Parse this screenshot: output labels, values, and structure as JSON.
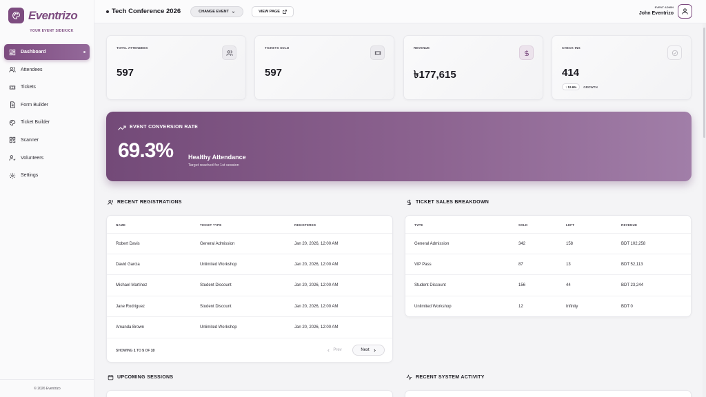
{
  "app": {
    "logo_text": "Eventrizo",
    "tagline": "YOUR EVENT SIDEKICK",
    "copyright": "© 2026 Eventrizo"
  },
  "colors": {
    "brand": "#7d4c80",
    "background": "#f4f4f6"
  },
  "sidebar": {
    "items": [
      {
        "label": "Dashboard",
        "icon": "dashboard-icon",
        "active": true
      },
      {
        "label": "Attendees",
        "icon": "users-icon"
      },
      {
        "label": "Tickets",
        "icon": "ticket-icon"
      },
      {
        "label": "Form Builder",
        "icon": "form-icon"
      },
      {
        "label": "Ticket Builder",
        "icon": "palette-icon"
      },
      {
        "label": "Scanner",
        "icon": "scan-icon"
      },
      {
        "label": "Volunteers",
        "icon": "volunteer-icon"
      },
      {
        "label": "Settings",
        "icon": "gear-icon"
      }
    ]
  },
  "header": {
    "event_title": "Tech Conference 2026",
    "change_event_label": "CHANGE EVENT",
    "view_page_label": "VIEW PAGE",
    "user_role": "EVENT ADMIN",
    "user_name": "John Eventrizo"
  },
  "stats": [
    {
      "label": "TOTAL ATTENDEES",
      "value": "597",
      "icon": "users-icon"
    },
    {
      "label": "TICKETS SOLD",
      "value": "597",
      "icon": "ticket-icon"
    },
    {
      "label": "REVENUE",
      "value": "৳177,615",
      "icon": "dollar-icon"
    },
    {
      "label": "CHECK-INS",
      "value": "414",
      "icon": "check-circle-icon",
      "growth": "↑ 12.6%",
      "growth_label": "GROWTH"
    }
  ],
  "conversion": {
    "title": "EVENT CONVERSION RATE",
    "rate": "69.3%",
    "status": "Healthy Attendance",
    "subtitle": "Target reached for 1st session"
  },
  "registrations": {
    "title": "RECENT REGISTRATIONS",
    "columns": [
      "NAME",
      "TICKET TYPE",
      "REGISTERED"
    ],
    "rows": [
      [
        "Robert Davis",
        "General Admission",
        "Jan 20, 2026, 12:00 AM"
      ],
      [
        "David Garcia",
        "Unlimited Workshop",
        "Jan 20, 2026, 12:00 AM"
      ],
      [
        "Michael Martinez",
        "Student Discount",
        "Jan 20, 2026, 12:00 AM"
      ],
      [
        "Jane Rodriguez",
        "Student Discount",
        "Jan 20, 2026, 12:00 AM"
      ],
      [
        "Amanda Brown",
        "Unlimited Workshop",
        "Jan 20, 2026, 12:00 AM"
      ]
    ],
    "showing_prefix": "SHOWING",
    "showing_from": "1",
    "showing_to_word": "TO",
    "showing_to": "5",
    "showing_of_word": "OF",
    "showing_total": "10",
    "prev_label": "Prev",
    "next_label": "Next"
  },
  "ticket_sales": {
    "title": "TICKET SALES BREAKDOWN",
    "columns": [
      "TYPE",
      "SOLD",
      "LEFT",
      "REVENUE"
    ],
    "rows": [
      [
        "General Admission",
        "342",
        "158",
        "BDT 102,258"
      ],
      [
        "VIP Pass",
        "87",
        "13",
        "BDT 52,113"
      ],
      [
        "Student Discount",
        "156",
        "44",
        "BDT 23,244"
      ],
      [
        "Unlimited Workshop",
        "12",
        "Infinity",
        "BDT 0"
      ]
    ]
  },
  "sections": {
    "upcoming_sessions": "UPCOMING SESSIONS",
    "system_activity": "RECENT SYSTEM ACTIVITY"
  }
}
